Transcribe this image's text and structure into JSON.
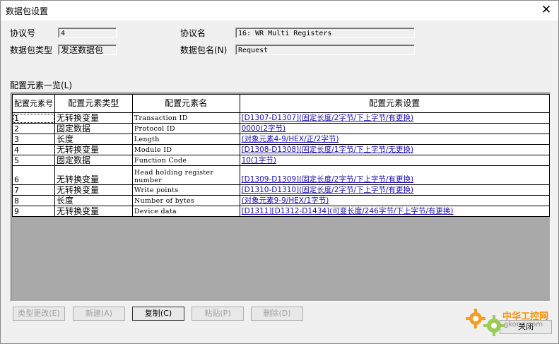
{
  "window": {
    "title": "数据包设置",
    "close_glyph": "✕"
  },
  "form": {
    "protocol_no_label": "协议号",
    "protocol_no_value": "4",
    "protocol_name_label": "协议名",
    "protocol_name_value": "16: WR Multi Registers",
    "packet_type_label": "数据包类型",
    "packet_type_value": "发送数据包",
    "packet_name_label": "数据包名(N)",
    "packet_name_value": "Request"
  },
  "list": {
    "label": "配置元素一览(L)",
    "headers": [
      "配置元素号",
      "配置元素类型",
      "配置元素名",
      "配置元素设置"
    ],
    "rows": [
      {
        "no": "1",
        "type": "无转换变量",
        "name": "Transaction ID",
        "setting": "[D1307-D1307](固定长度/2字节/下上字节/有更换)"
      },
      {
        "no": "2",
        "type": "固定数据",
        "name": "Protocol ID",
        "setting": "0000(2字节)"
      },
      {
        "no": "3",
        "type": "长度",
        "name": "Length",
        "setting": "(对象元素4-9/HEX/正/2字节)"
      },
      {
        "no": "4",
        "type": "无转换变量",
        "name": "Module ID",
        "setting": "[D1308-D1308](固定长度/1字节/下上字节/无更换)"
      },
      {
        "no": "5",
        "type": "固定数据",
        "name": "Function Code",
        "setting": "10(1字节)"
      },
      {
        "no": "6",
        "type": "无转换变量",
        "name": "Head holding register number",
        "setting": "[D1309-D1309](固定长度/2字节/下上字节/有更换)"
      },
      {
        "no": "7",
        "type": "无转换变量",
        "name": "Write points",
        "setting": "[D1310-D1310](固定长度/2字节/下上字节/有更换)"
      },
      {
        "no": "8",
        "type": "长度",
        "name": "Number of bytes",
        "setting": "(对象元素9-9/HEX/1字节)"
      },
      {
        "no": "9",
        "type": "无转换变量",
        "name": "Device data",
        "setting": "[D1311][D1312-D1434](可变长度/246字节/下上字节/有更换)"
      }
    ]
  },
  "buttons": {
    "change_type": "类型更改(E)",
    "new": "新建(A)",
    "copy": "复制(C)",
    "paste": "粘贴(P)",
    "delete": "删除(D)",
    "close": "关闭"
  },
  "watermark": {
    "text1": "中华工控网",
    "text2": "gkong.com",
    "color": "#f39200"
  }
}
